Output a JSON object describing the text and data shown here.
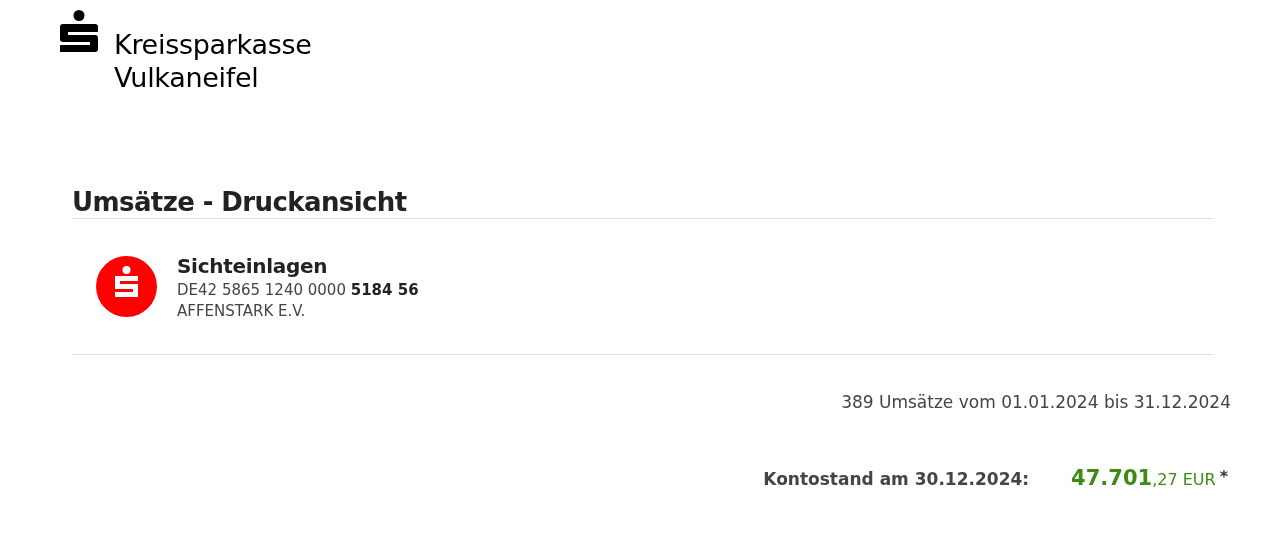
{
  "bank": {
    "name_line_1": "Kreissparkasse",
    "name_line_2": "Vulkaneifel"
  },
  "heading": "Umsätze - Druckansicht",
  "account": {
    "name": "Sichteinlagen",
    "iban": "DE42 5865 1240 0000 **5184 56**",
    "holder": "AFFENSTARK E.V."
  },
  "summary": "389 Umsätze vom 01.01.2024 bis 31.12.2024",
  "balance": {
    "label": "Kontostand am 30.12.2024:",
    "amount": "**47.701**,27 EUR",
    "footnote": "*"
  }
}
